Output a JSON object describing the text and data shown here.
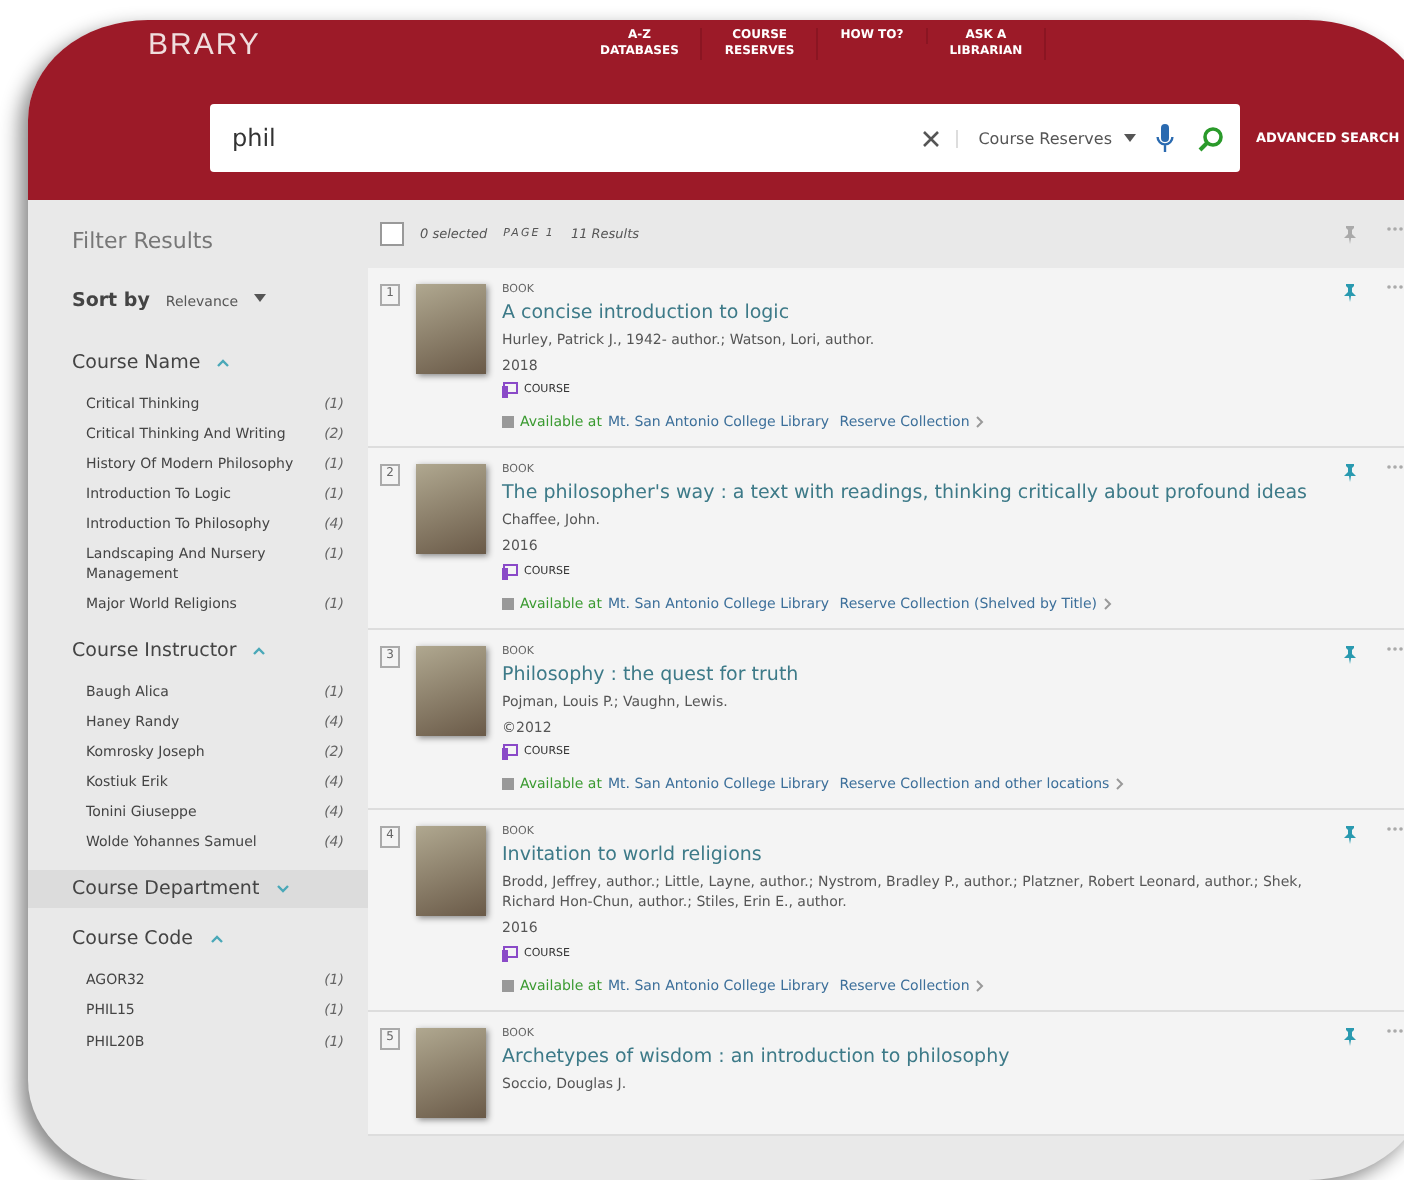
{
  "header": {
    "logo": "BRARY",
    "nav": [
      {
        "line1": "A-Z",
        "line2": "DATABASES"
      },
      {
        "line1": "COURSE",
        "line2": "RESERVES"
      },
      {
        "line1": "HOW TO?"
      },
      {
        "line1": "ASK A",
        "line2": "LIBRARIAN"
      }
    ],
    "search": {
      "value": "phil",
      "scope": "Course Reserves"
    },
    "advanced": "ADVANCED SEARCH"
  },
  "toolbar": {
    "checked": false,
    "selected_count": "0 selected",
    "page": "PAGE 1",
    "results": "11 Results"
  },
  "filters": {
    "title": "Filter Results",
    "sort_label": "Sort by",
    "sort_value": "Relevance",
    "groups": [
      {
        "name": "Course Name",
        "expanded": true,
        "items": [
          {
            "label": "Critical Thinking",
            "count": "(1)"
          },
          {
            "label": "Critical Thinking And Writing",
            "count": "(2)"
          },
          {
            "label": "History Of Modern Philosophy",
            "count": "(1)"
          },
          {
            "label": "Introduction To Logic",
            "count": "(1)"
          },
          {
            "label": "Introduction To Philosophy",
            "count": "(4)"
          },
          {
            "label": "Landscaping And Nursery Management",
            "count": "(1)"
          },
          {
            "label": "Major World Religions",
            "count": "(1)"
          }
        ]
      },
      {
        "name": "Course Instructor",
        "expanded": true,
        "items": [
          {
            "label": "Baugh Alica",
            "count": "(1)"
          },
          {
            "label": "Haney Randy",
            "count": "(4)"
          },
          {
            "label": "Komrosky Joseph",
            "count": "(2)"
          },
          {
            "label": "Kostiuk Erik",
            "count": "(4)"
          },
          {
            "label": "Tonini Giuseppe",
            "count": "(4)"
          },
          {
            "label": "Wolde Yohannes Samuel",
            "count": "(4)"
          }
        ]
      },
      {
        "name": "Course Department",
        "expanded": false
      },
      {
        "name": "Course Code",
        "expanded": true,
        "items": [
          {
            "label": "AGOR32",
            "count": "(1)"
          },
          {
            "label": "PHIL15",
            "count": "(1)"
          },
          {
            "label": "PHIL20B",
            "count": "(1)"
          }
        ]
      }
    ]
  },
  "results": [
    {
      "index": "1",
      "type": "BOOK",
      "title": "A concise introduction to logic",
      "authors": "Hurley, Patrick J., 1942- author.; Watson, Lori, author.",
      "year": "2018",
      "tag": "COURSE",
      "available": "Available at",
      "library": "Mt. San Antonio College Library",
      "location": "Reserve Collection"
    },
    {
      "index": "2",
      "type": "BOOK",
      "title": "The philosopher's way : a text with readings, thinking critically about profound ideas",
      "authors": "Chaffee, John.",
      "year": "2016",
      "tag": "COURSE",
      "available": "Available at",
      "library": "Mt. San Antonio College Library",
      "location": "Reserve Collection (Shelved by Title)"
    },
    {
      "index": "3",
      "type": "BOOK",
      "title": "Philosophy : the quest for truth",
      "authors": "Pojman, Louis P.; Vaughn, Lewis.",
      "year": "©2012",
      "tag": "COURSE",
      "available": "Available at",
      "library": "Mt. San Antonio College Library",
      "location": "Reserve Collection and other locations"
    },
    {
      "index": "4",
      "type": "BOOK",
      "title": "Invitation to world religions",
      "authors": "Brodd, Jeffrey, author.; Little, Layne, author.; Nystrom, Bradley P., author.; Platzner, Robert Leonard, author.; Shek, Richard Hon-Chun, author.; Stiles, Erin E., author.",
      "year": "2016",
      "tag": "COURSE",
      "available": "Available at",
      "library": "Mt. San Antonio College Library",
      "location": "Reserve Collection"
    },
    {
      "index": "5",
      "type": "BOOK",
      "title": "Archetypes of wisdom : an introduction to philosophy",
      "authors": "Soccio, Douglas J."
    }
  ]
}
